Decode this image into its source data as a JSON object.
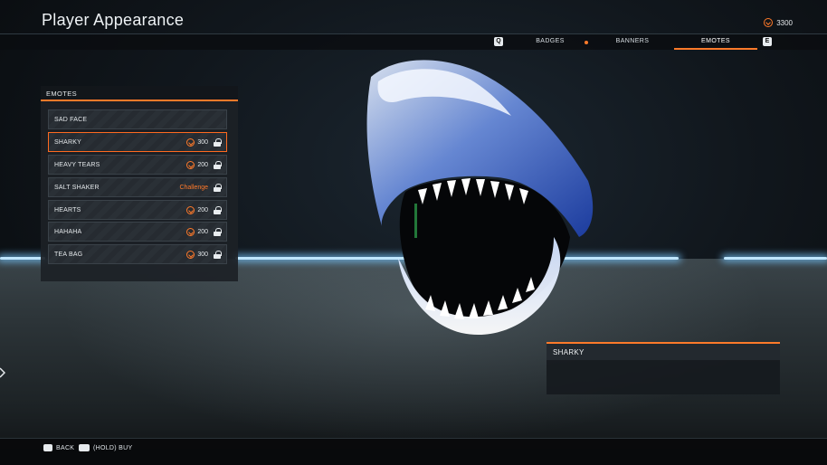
{
  "header": {
    "title": "Player Appearance",
    "currency": {
      "amount": "3300",
      "icon": "coin-icon",
      "color": "#ff7a2a"
    }
  },
  "tabs": {
    "prev_key": "Q",
    "next_key": "E",
    "items": [
      {
        "label": "BADGES",
        "selected": false
      },
      {
        "label": "BANNERS",
        "selected": false
      },
      {
        "label": "EMOTES",
        "selected": true
      }
    ]
  },
  "emotes_panel": {
    "title": "EMOTES",
    "items": [
      {
        "name": "SAD FACE",
        "price": "",
        "price_type": "owned",
        "locked": false,
        "selected": false
      },
      {
        "name": "SHARKY",
        "price": "300",
        "price_type": "currency",
        "locked": true,
        "selected": true
      },
      {
        "name": "HEAVY TEARS",
        "price": "200",
        "price_type": "currency",
        "locked": true,
        "selected": false
      },
      {
        "name": "SALT SHAKER",
        "price": "Challenge",
        "price_type": "challenge",
        "locked": true,
        "selected": false
      },
      {
        "name": "HEARTS",
        "price": "200",
        "price_type": "currency",
        "locked": true,
        "selected": false
      },
      {
        "name": "HAHAHA",
        "price": "200",
        "price_type": "currency",
        "locked": true,
        "selected": false
      },
      {
        "name": "TEA BAG",
        "price": "300",
        "price_type": "currency",
        "locked": true,
        "selected": false
      }
    ]
  },
  "detail": {
    "title": "SHARKY"
  },
  "footer": {
    "back_label": "BACK",
    "buy_label": "(HOLD) BUY"
  },
  "theme": {
    "accent": "#ff7a2a",
    "glow": "#bfe6ff"
  }
}
